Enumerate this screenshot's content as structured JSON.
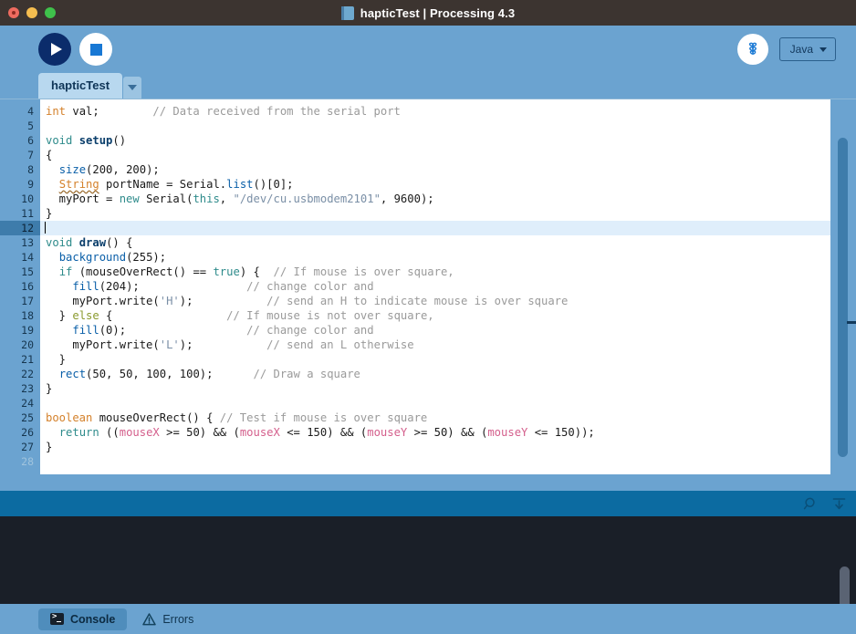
{
  "window": {
    "title": "hapticTest | Processing 4.3",
    "icon": "sketch-book-icon",
    "controls": [
      "close",
      "minimize",
      "maximize"
    ]
  },
  "toolbar": {
    "run_label": "Run",
    "stop_label": "Stop",
    "debug_label": "Debug",
    "mode": "Java",
    "mode_caret": "▾"
  },
  "tabs": {
    "items": [
      {
        "label": "hapticTest",
        "active": true
      }
    ],
    "menu_caret": "▾"
  },
  "editor": {
    "first_line": 4,
    "current_line": 12,
    "lines": [
      {
        "n": 4,
        "tokens": [
          {
            "t": "int",
            "c": "k-type"
          },
          {
            "t": " val;",
            "c": "k-plain"
          },
          {
            "t": "        ",
            "c": "k-plain"
          },
          {
            "t": "// Data received from the serial port",
            "c": "k-com"
          }
        ]
      },
      {
        "n": 5,
        "tokens": []
      },
      {
        "n": 6,
        "tokens": [
          {
            "t": "void",
            "c": "k-kw"
          },
          {
            "t": " ",
            "c": "k-plain"
          },
          {
            "t": "setup",
            "c": "k-fnb"
          },
          {
            "t": "()",
            "c": "k-plain"
          }
        ]
      },
      {
        "n": 7,
        "tokens": [
          {
            "t": "{",
            "c": "k-plain"
          }
        ]
      },
      {
        "n": 8,
        "tokens": [
          {
            "t": "  ",
            "c": "k-plain"
          },
          {
            "t": "size",
            "c": "k-fn"
          },
          {
            "t": "(200, 200);",
            "c": "k-plain"
          }
        ]
      },
      {
        "n": 9,
        "tokens": [
          {
            "t": "  ",
            "c": "k-plain"
          },
          {
            "t": "String",
            "c": "k-type squiggle"
          },
          {
            "t": " portName = Serial.",
            "c": "k-plain"
          },
          {
            "t": "list",
            "c": "k-fn"
          },
          {
            "t": "()[0];",
            "c": "k-plain"
          }
        ]
      },
      {
        "n": 10,
        "tokens": [
          {
            "t": "  myPort = ",
            "c": "k-plain"
          },
          {
            "t": "new",
            "c": "k-kw"
          },
          {
            "t": " Serial(",
            "c": "k-plain"
          },
          {
            "t": "this",
            "c": "k-kw"
          },
          {
            "t": ", ",
            "c": "k-plain"
          },
          {
            "t": "\"/dev/cu.usbmodem2101\"",
            "c": "k-str"
          },
          {
            "t": ", 9600);",
            "c": "k-plain"
          }
        ]
      },
      {
        "n": 11,
        "tokens": [
          {
            "t": "}",
            "c": "k-plain"
          }
        ]
      },
      {
        "n": 12,
        "tokens": [],
        "current": true,
        "caret": true
      },
      {
        "n": 13,
        "tokens": [
          {
            "t": "void",
            "c": "k-kw"
          },
          {
            "t": " ",
            "c": "k-plain"
          },
          {
            "t": "draw",
            "c": "k-fnb"
          },
          {
            "t": "() {",
            "c": "k-plain"
          }
        ]
      },
      {
        "n": 14,
        "tokens": [
          {
            "t": "  ",
            "c": "k-plain"
          },
          {
            "t": "background",
            "c": "k-fn"
          },
          {
            "t": "(255);",
            "c": "k-plain"
          }
        ]
      },
      {
        "n": 15,
        "tokens": [
          {
            "t": "  ",
            "c": "k-plain"
          },
          {
            "t": "if",
            "c": "k-kw"
          },
          {
            "t": " (mouseOverRect() == ",
            "c": "k-plain"
          },
          {
            "t": "true",
            "c": "k-kw"
          },
          {
            "t": ") {  ",
            "c": "k-plain"
          },
          {
            "t": "// If mouse is over square,",
            "c": "k-com"
          }
        ]
      },
      {
        "n": 16,
        "tokens": [
          {
            "t": "    ",
            "c": "k-plain"
          },
          {
            "t": "fill",
            "c": "k-fn"
          },
          {
            "t": "(204);",
            "c": "k-plain"
          },
          {
            "t": "                ",
            "c": "k-plain"
          },
          {
            "t": "// change color and",
            "c": "k-com"
          }
        ]
      },
      {
        "n": 17,
        "tokens": [
          {
            "t": "    myPort.write(",
            "c": "k-plain"
          },
          {
            "t": "'H'",
            "c": "k-str"
          },
          {
            "t": ");",
            "c": "k-plain"
          },
          {
            "t": "           ",
            "c": "k-plain"
          },
          {
            "t": "// send an H to indicate mouse is over square",
            "c": "k-com"
          }
        ]
      },
      {
        "n": 18,
        "tokens": [
          {
            "t": "  } ",
            "c": "k-plain"
          },
          {
            "t": "else",
            "c": "k-kw2"
          },
          {
            "t": " {",
            "c": "k-plain"
          },
          {
            "t": "                 ",
            "c": "k-plain"
          },
          {
            "t": "// If mouse is not over square,",
            "c": "k-com"
          }
        ]
      },
      {
        "n": 19,
        "tokens": [
          {
            "t": "    ",
            "c": "k-plain"
          },
          {
            "t": "fill",
            "c": "k-fn"
          },
          {
            "t": "(0);",
            "c": "k-plain"
          },
          {
            "t": "                  ",
            "c": "k-plain"
          },
          {
            "t": "// change color and",
            "c": "k-com"
          }
        ]
      },
      {
        "n": 20,
        "tokens": [
          {
            "t": "    myPort.write(",
            "c": "k-plain"
          },
          {
            "t": "'L'",
            "c": "k-str"
          },
          {
            "t": ");",
            "c": "k-plain"
          },
          {
            "t": "           ",
            "c": "k-plain"
          },
          {
            "t": "// send an L otherwise",
            "c": "k-com"
          }
        ]
      },
      {
        "n": 21,
        "tokens": [
          {
            "t": "  }",
            "c": "k-plain"
          }
        ]
      },
      {
        "n": 22,
        "tokens": [
          {
            "t": "  ",
            "c": "k-plain"
          },
          {
            "t": "rect",
            "c": "k-fn"
          },
          {
            "t": "(50, 50, 100, 100);",
            "c": "k-plain"
          },
          {
            "t": "      ",
            "c": "k-plain"
          },
          {
            "t": "// Draw a square",
            "c": "k-com"
          }
        ]
      },
      {
        "n": 23,
        "tokens": [
          {
            "t": "}",
            "c": "k-plain"
          }
        ]
      },
      {
        "n": 24,
        "tokens": []
      },
      {
        "n": 25,
        "tokens": [
          {
            "t": "boolean",
            "c": "k-type"
          },
          {
            "t": " mouseOverRect() { ",
            "c": "k-plain"
          },
          {
            "t": "// Test if mouse is over square",
            "c": "k-com"
          }
        ]
      },
      {
        "n": 26,
        "tokens": [
          {
            "t": "  ",
            "c": "k-plain"
          },
          {
            "t": "return",
            "c": "k-kw"
          },
          {
            "t": " ((",
            "c": "k-plain"
          },
          {
            "t": "mouseX",
            "c": "k-var"
          },
          {
            "t": " >= 50) && (",
            "c": "k-plain"
          },
          {
            "t": "mouseX",
            "c": "k-var"
          },
          {
            "t": " <= 150) && (",
            "c": "k-plain"
          },
          {
            "t": "mouseY",
            "c": "k-var"
          },
          {
            "t": " >= 50) && (",
            "c": "k-plain"
          },
          {
            "t": "mouseY",
            "c": "k-var"
          },
          {
            "t": " <= 150));",
            "c": "k-plain"
          }
        ]
      },
      {
        "n": 27,
        "tokens": [
          {
            "t": "}",
            "c": "k-plain"
          }
        ]
      },
      {
        "n": 28,
        "tokens": [],
        "past": true
      }
    ]
  },
  "console_toolbar": {
    "search_icon": "magnifier-icon",
    "scroll_bottom_icon": "scroll-to-bottom-icon"
  },
  "console": {
    "output": ""
  },
  "bottom_tabs": [
    {
      "label": "Console",
      "icon": "terminal-icon",
      "active": true
    },
    {
      "label": "Errors",
      "icon": "warning-triangle-icon",
      "active": false
    }
  ],
  "colors": {
    "titlebar": "#3c3430",
    "chrome": "#6ba3d0",
    "editor_bg": "#ffffff",
    "current_line": "#dfeefb",
    "console_bg": "#1a1f28",
    "status_bar": "#0c6ba1",
    "run_button": "#0b2c6b",
    "accent_blue": "#1878d4",
    "tab_active": "#b8d8ef"
  }
}
